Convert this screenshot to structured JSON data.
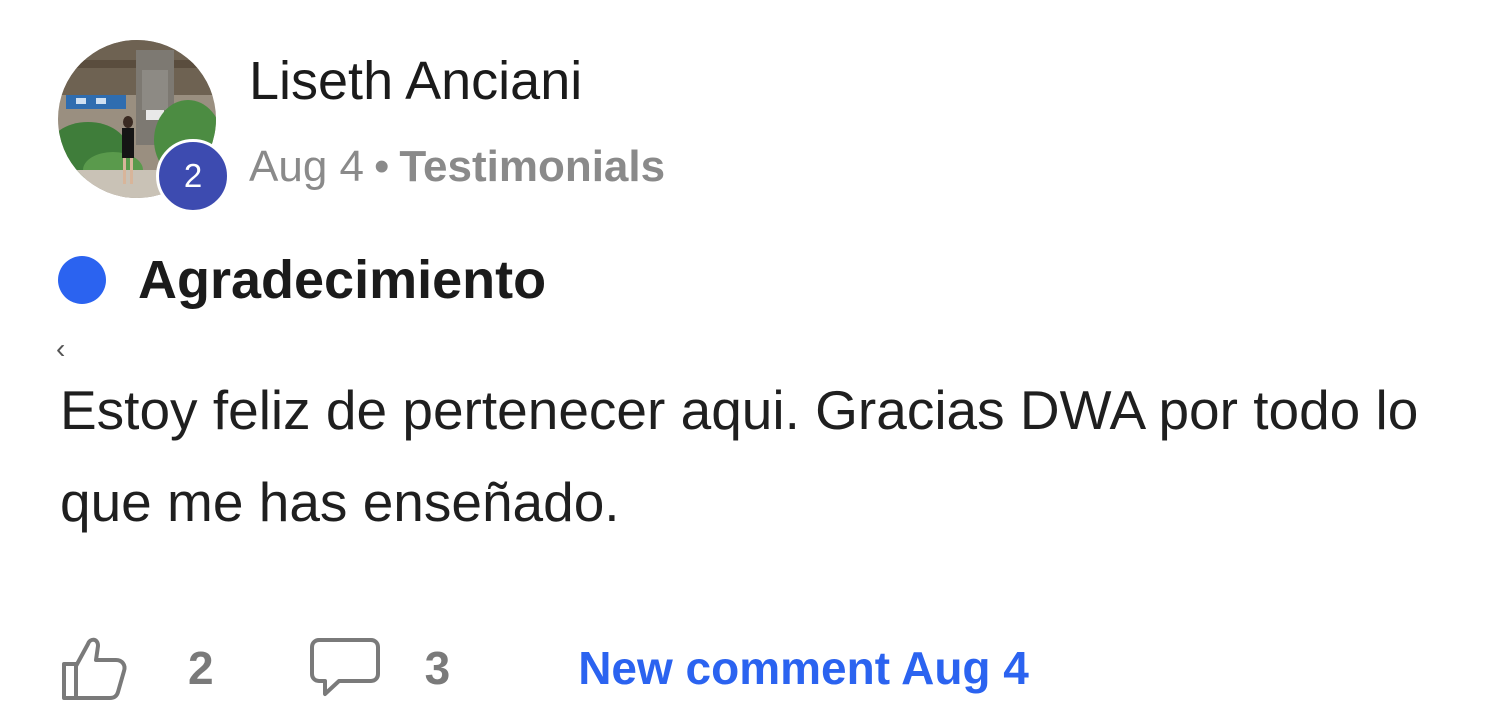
{
  "author": {
    "name": "Liseth Anciani",
    "level": "2"
  },
  "meta": {
    "date": "Aug 4",
    "separator": "•",
    "category": "Testimonials"
  },
  "post": {
    "title": "Agradecimiento",
    "body": "Estoy feliz de pertenecer aqui. Gracias DWA por todo lo que me has enseñado.",
    "prev_glyph": "‹"
  },
  "footer": {
    "like_count": "2",
    "comment_count": "3",
    "new_comment_label": "New comment Aug 4"
  },
  "icons": {
    "like": "thumbs-up-icon",
    "comment": "speech-bubble-icon",
    "unread": "unread-dot-icon"
  },
  "colors": {
    "accent": "#2b63f0",
    "badge": "#3d4bb0",
    "muted": "#8a8a8a",
    "text": "#1b1b1b"
  }
}
